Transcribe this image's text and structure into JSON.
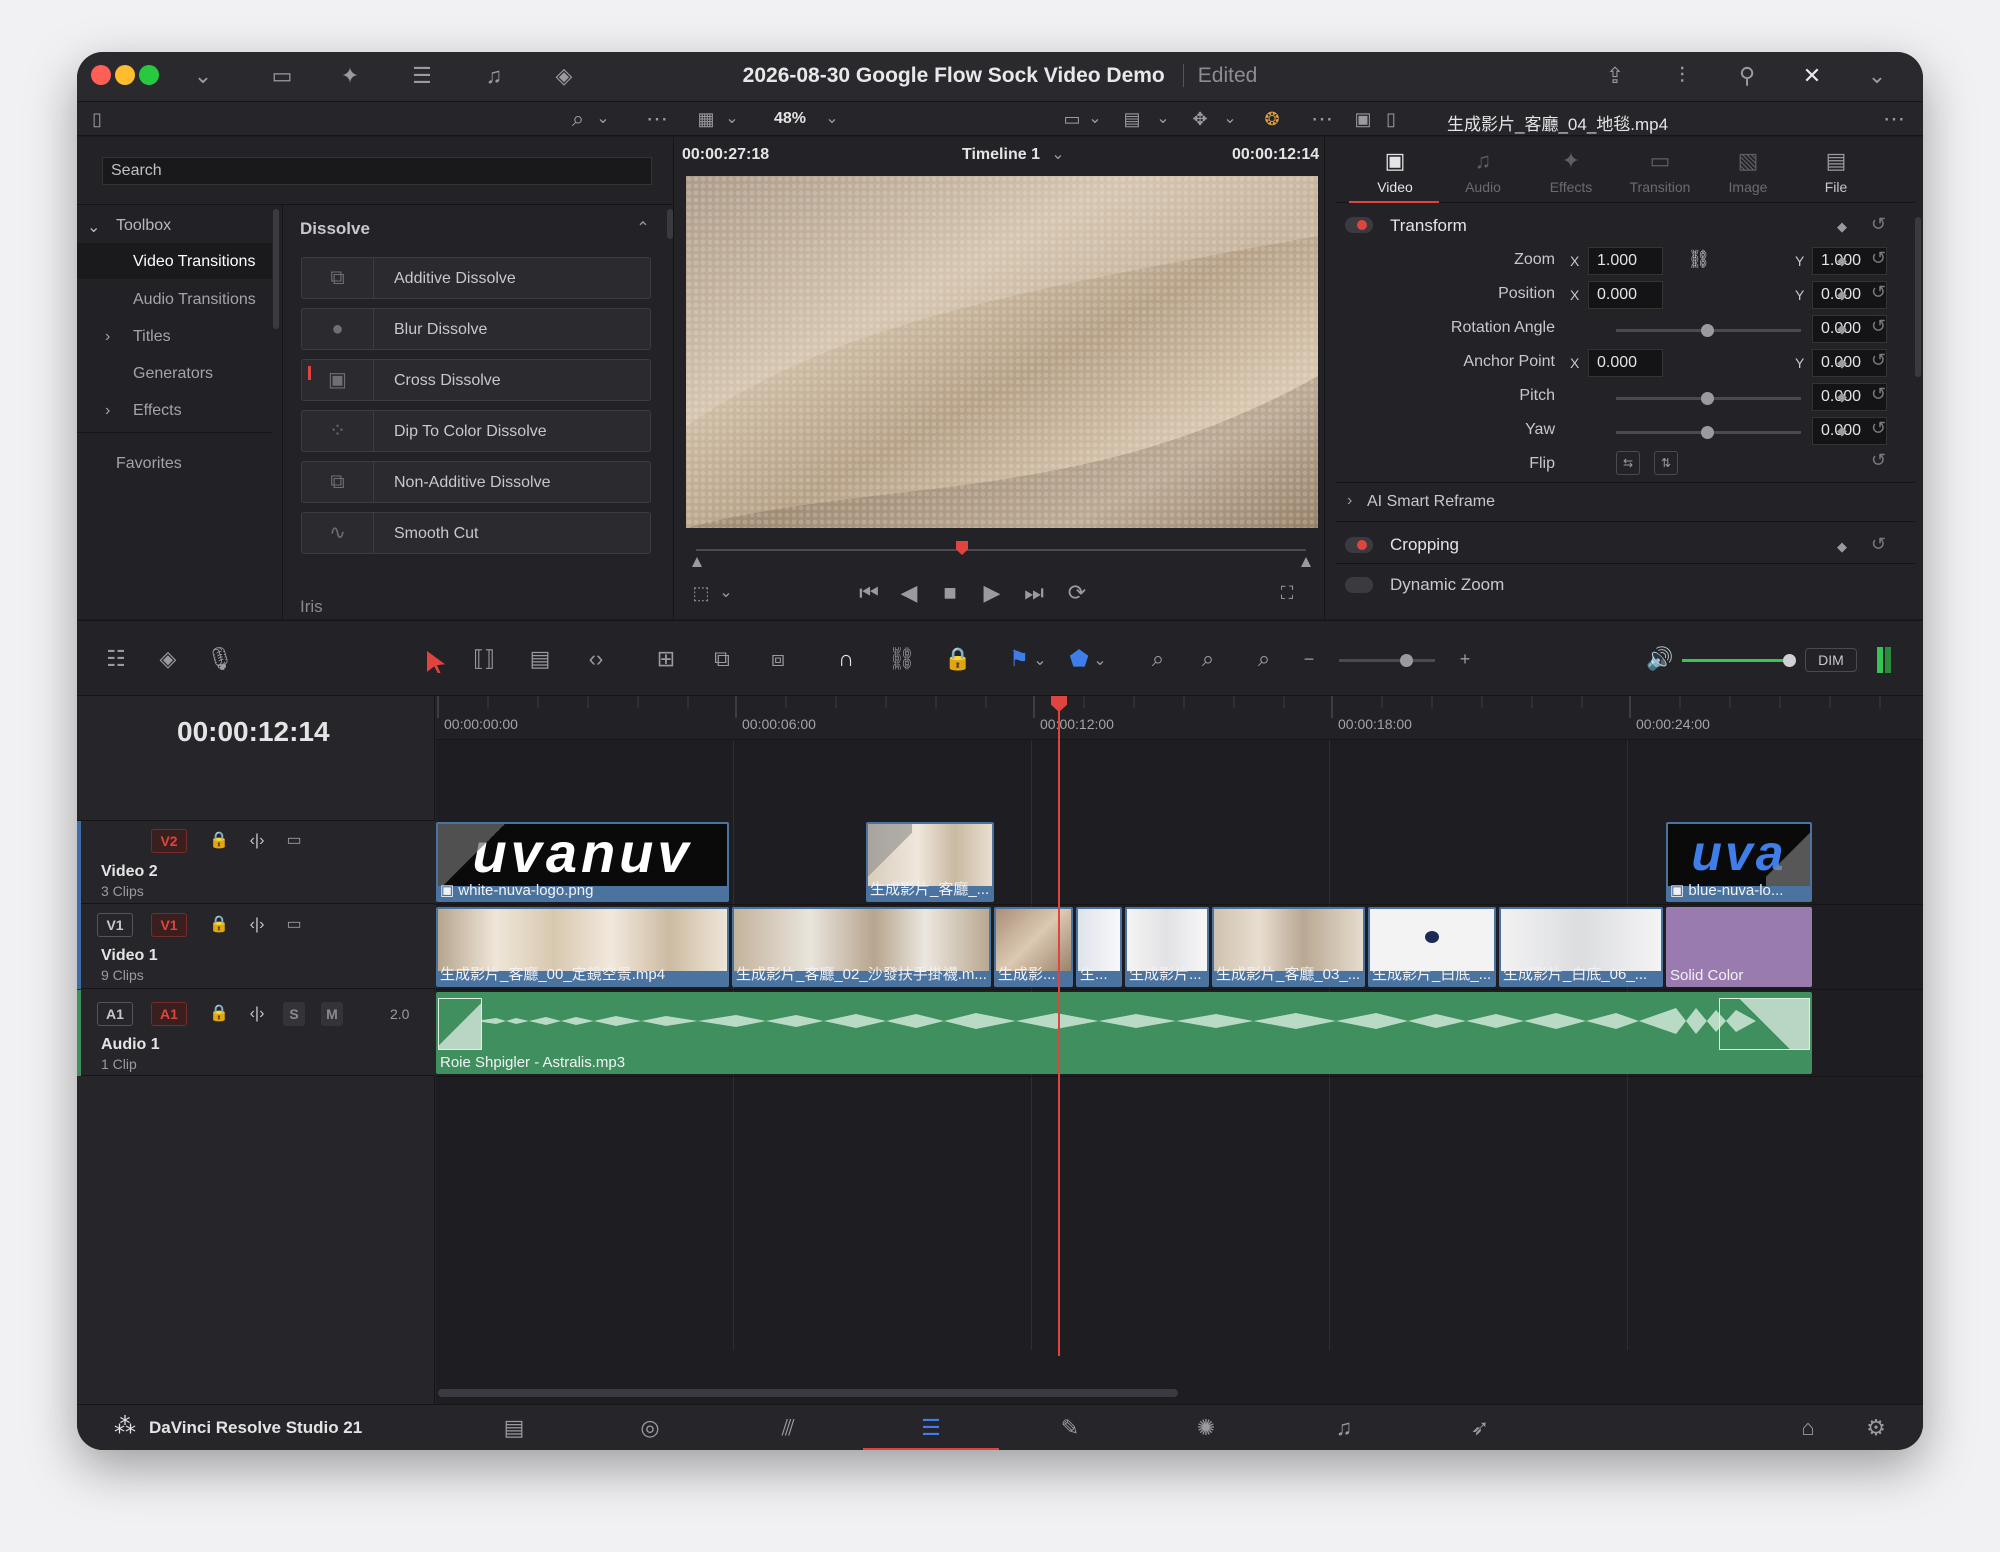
{
  "window": {
    "title": "2026-08-30 Google Flow Sock Video Demo",
    "status": "Edited"
  },
  "media": {
    "search_placeholder": "Search"
  },
  "toolbox": {
    "items": [
      {
        "label": "Toolbox"
      },
      {
        "label": "Video Transitions"
      },
      {
        "label": "Audio Transitions"
      },
      {
        "label": "Titles"
      },
      {
        "label": "Generators"
      },
      {
        "label": "Effects"
      }
    ],
    "favorites": "Favorites"
  },
  "dissolve": {
    "header": "Dissolve",
    "items": [
      "Additive Dissolve",
      "Blur Dissolve",
      "Cross Dissolve",
      "Dip To Color Dissolve",
      "Non-Additive Dissolve",
      "Smooth Cut"
    ],
    "next_header": "Iris"
  },
  "viewer": {
    "zoom": "48%",
    "timecode_left": "00:00:27:18",
    "timeline_name": "Timeline 1",
    "timecode_right": "00:00:12:14"
  },
  "inspector": {
    "clip_name": "生成影片_客廳_04_地毯.mp4",
    "tabs": [
      "Video",
      "Audio",
      "Effects",
      "Transition",
      "Image",
      "File"
    ],
    "transform_label": "Transform",
    "zoom": {
      "label": "Zoom",
      "x": "1.000",
      "y": "1.000"
    },
    "position": {
      "label": "Position",
      "x": "0.000",
      "y": "0.000"
    },
    "rotation": {
      "label": "Rotation Angle",
      "value": "0.000"
    },
    "anchor": {
      "label": "Anchor Point",
      "x": "0.000",
      "y": "0.000"
    },
    "pitch": {
      "label": "Pitch",
      "value": "0.000"
    },
    "yaw": {
      "label": "Yaw",
      "value": "0.000"
    },
    "flip": {
      "label": "Flip"
    },
    "ai_reframe": "AI Smart Reframe",
    "cropping": "Cropping",
    "dynamic_zoom": "Dynamic Zoom",
    "x_label": "X",
    "y_label": "Y"
  },
  "timeline": {
    "timecode": "00:00:12:14",
    "ruler": [
      "00:00:00:00",
      "00:00:06:00",
      "00:00:12:00",
      "00:00:18:00",
      "00:00:24:00"
    ],
    "dim_label": "DIM",
    "tracks": {
      "v2": {
        "badge": "V2",
        "name": "Video 2",
        "count": "3 Clips"
      },
      "v1": {
        "badge_src": "V1",
        "badge": "V1",
        "name": "Video 1",
        "count": "9 Clips"
      },
      "a1": {
        "badge_src": "A1",
        "badge": "A1",
        "name": "Audio 1",
        "count": "1 Clip",
        "solo": "S",
        "mute": "M",
        "channels": "2.0"
      }
    },
    "v2_clips": [
      "white-nuva-logo.png",
      "生成影片_客廳_...",
      "blue-nuva-lo..."
    ],
    "v1_clips": [
      "生成影片_客廳_00_定鏡空景.mp4",
      "生成影片_客廳_02_沙發扶手掛襪.m...",
      "生成影...",
      "生...",
      "生成影片...",
      "生成影片_客廳_03_...",
      "生成影片_白底_...",
      "生成影片_白底_06_...",
      "Solid Color"
    ],
    "a1_clip": "Roie Shpigler - Astralis.mp3",
    "logo_text": "uvanuv",
    "logo_text_blue": "uva"
  },
  "app": {
    "name": "DaVinci Resolve Studio 21"
  },
  "colors": {
    "accent": "#e0443e",
    "video_clip": "#4a73a0",
    "audio_clip": "#3f8f5f",
    "solid_color": "#9a7bb0"
  }
}
